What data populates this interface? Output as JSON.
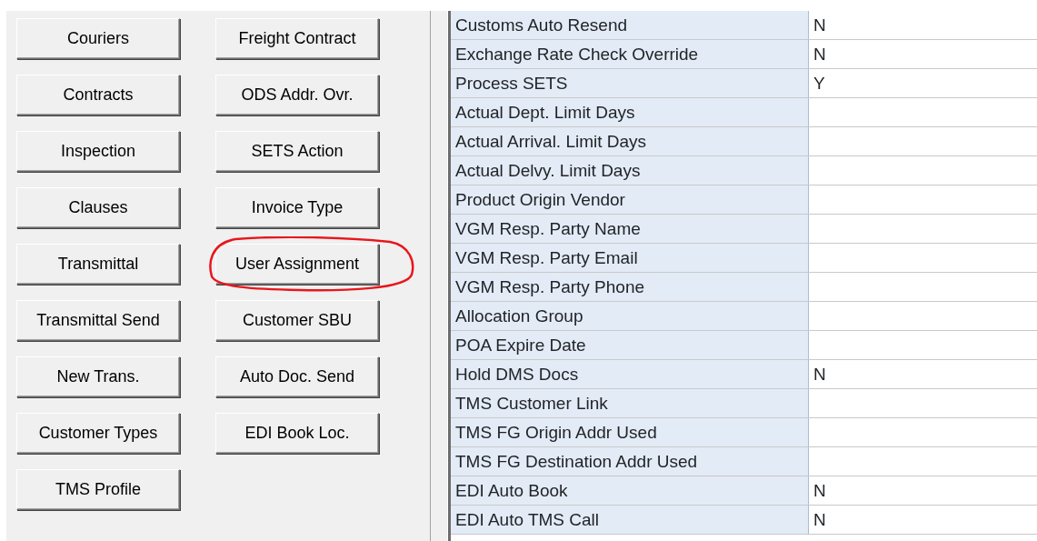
{
  "button_columns": [
    {
      "buttons": [
        {
          "label": "Couriers",
          "highlighted": false
        },
        {
          "label": "Contracts",
          "highlighted": false
        },
        {
          "label": "Inspection",
          "highlighted": false
        },
        {
          "label": "Clauses",
          "highlighted": false
        },
        {
          "label": "Transmittal",
          "highlighted": false
        },
        {
          "label": "Transmittal Send",
          "highlighted": false
        },
        {
          "label": "New Trans.",
          "highlighted": false
        },
        {
          "label": "Customer Types",
          "highlighted": false
        },
        {
          "label": "TMS Profile",
          "highlighted": false
        }
      ]
    },
    {
      "buttons": [
        {
          "label": "Freight Contract",
          "highlighted": false
        },
        {
          "label": "ODS Addr. Ovr.",
          "highlighted": false
        },
        {
          "label": "SETS Action",
          "highlighted": false
        },
        {
          "label": "Invoice Type",
          "highlighted": false
        },
        {
          "label": "User Assignment",
          "highlighted": true
        },
        {
          "label": "Customer SBU",
          "highlighted": false
        },
        {
          "label": "Auto Doc. Send",
          "highlighted": false
        },
        {
          "label": "EDI Book Loc.",
          "highlighted": false
        }
      ]
    }
  ],
  "properties": [
    {
      "label": "Customs Auto Resend",
      "value": "N"
    },
    {
      "label": "Exchange Rate Check Override",
      "value": "N"
    },
    {
      "label": "Process SETS",
      "value": "Y"
    },
    {
      "label": "Actual Dept. Limit Days"
    },
    {
      "label": "Actual Arrival. Limit Days"
    },
    {
      "label": "Actual Delvy. Limit Days"
    },
    {
      "label": "Product Origin Vendor"
    },
    {
      "label": "VGM Resp. Party Name"
    },
    {
      "label": "VGM Resp. Party Email"
    },
    {
      "label": "VGM Resp. Party Phone"
    },
    {
      "label": "Allocation Group"
    },
    {
      "label": "POA Expire Date"
    },
    {
      "label": "Hold DMS Docs",
      "value": "N"
    },
    {
      "label": "TMS Customer Link"
    },
    {
      "label": "TMS FG Origin Addr Used"
    },
    {
      "label": "TMS FG Destination Addr Used"
    },
    {
      "label": "EDI Auto Book",
      "value": "N"
    },
    {
      "label": "EDI Auto TMS Call",
      "value": "N"
    }
  ]
}
